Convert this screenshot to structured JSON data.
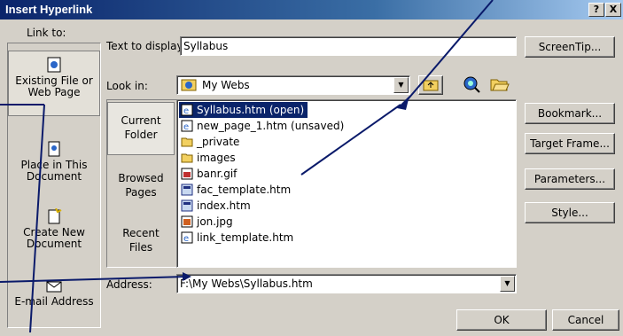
{
  "window": {
    "title": "Insert Hyperlink",
    "help": "?",
    "close": "X"
  },
  "link_to": {
    "label": "Link to:",
    "items": [
      {
        "line1": "Existing File or",
        "line2": "Web Page",
        "icon": "web-page-icon"
      },
      {
        "line1": "Place in This",
        "line2": "Document",
        "icon": "place-in-document-icon"
      },
      {
        "line1": "Create New",
        "line2": "Document",
        "icon": "new-document-icon"
      },
      {
        "line1": "E-mail Address",
        "line2": "",
        "icon": "email-icon"
      }
    ]
  },
  "text_to_display": {
    "label": "Text to display:",
    "value": "Syllabus"
  },
  "look_in": {
    "label": "Look in:",
    "value": "My Webs"
  },
  "look_in_bar": [
    {
      "line1": "Current",
      "line2": "Folder"
    },
    {
      "line1": "Browsed",
      "line2": "Pages"
    },
    {
      "line1": "Recent",
      "line2": "Files"
    }
  ],
  "files": [
    {
      "name": "Syllabus.htm (open)",
      "icon": "html-file-icon"
    },
    {
      "name": "new_page_1.htm (unsaved)",
      "icon": "html-file-icon"
    },
    {
      "name": "_private",
      "icon": "folder-icon"
    },
    {
      "name": "images",
      "icon": "folder-icon"
    },
    {
      "name": "banr.gif",
      "icon": "image-file-icon"
    },
    {
      "name": "fac_template.htm",
      "icon": "template-file-icon"
    },
    {
      "name": "index.htm",
      "icon": "template-file-icon"
    },
    {
      "name": "jon.jpg",
      "icon": "image-file-icon"
    },
    {
      "name": "link_template.htm",
      "icon": "html-file-icon"
    }
  ],
  "address": {
    "label": "Address:",
    "value": "F:\\My Webs\\Syllabus.htm"
  },
  "buttons": {
    "screentip": "ScreenTip...",
    "bookmark": "Bookmark...",
    "target_frame": "Target Frame...",
    "parameters": "Parameters...",
    "style": "Style...",
    "ok": "OK",
    "cancel": "Cancel"
  },
  "colors": {
    "title_bar": "#0a246a",
    "selection": "#0a246a",
    "dialog": "#d4d0c8",
    "arrow": "#0a1a6a"
  }
}
